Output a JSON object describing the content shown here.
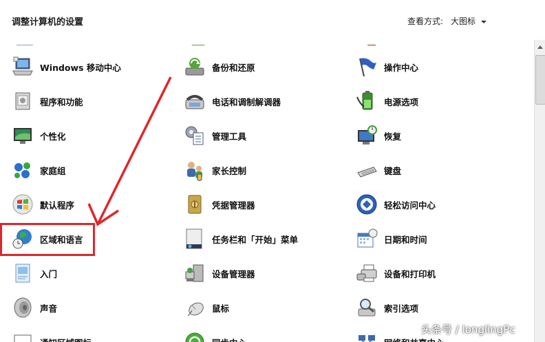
{
  "header": {
    "title": "调整计算机的设置",
    "view_by_label": "查看方式:",
    "view_by_value": "大图标"
  },
  "items": [
    {
      "id": "windows-mobility",
      "label": "Windows 移动中心",
      "icon": "laptop-icon"
    },
    {
      "id": "backup-restore",
      "label": "备份和还原",
      "icon": "backup-icon"
    },
    {
      "id": "action-center",
      "label": "操作中心",
      "icon": "flag-icon"
    },
    {
      "id": "programs-features",
      "label": "程序和功能",
      "icon": "programs-icon"
    },
    {
      "id": "phone-modem",
      "label": "电话和调制解调器",
      "icon": "phone-icon"
    },
    {
      "id": "power-options",
      "label": "电源选项",
      "icon": "battery-icon"
    },
    {
      "id": "personalization",
      "label": "个性化",
      "icon": "monitor-icon"
    },
    {
      "id": "admin-tools",
      "label": "管理工具",
      "icon": "gear-checklist-icon"
    },
    {
      "id": "recovery",
      "label": "恢复",
      "icon": "recovery-icon"
    },
    {
      "id": "homegroup",
      "label": "家庭组",
      "icon": "homegroup-icon"
    },
    {
      "id": "parental-controls",
      "label": "家长控制",
      "icon": "parental-icon"
    },
    {
      "id": "keyboard",
      "label": "键盘",
      "icon": "keyboard-icon"
    },
    {
      "id": "default-programs",
      "label": "默认程序",
      "icon": "windows-logo-icon"
    },
    {
      "id": "credential-manager",
      "label": "凭据管理器",
      "icon": "vault-icon"
    },
    {
      "id": "ease-of-access",
      "label": "轻松访问中心",
      "icon": "accessibility-icon"
    },
    {
      "id": "region-language",
      "label": "区域和语言",
      "icon": "globe-clock-icon"
    },
    {
      "id": "taskbar-start",
      "label": "任务栏和「开始」菜单",
      "icon": "taskbar-icon"
    },
    {
      "id": "date-time",
      "label": "日期和时间",
      "icon": "calendar-icon"
    },
    {
      "id": "getting-started",
      "label": "入门",
      "icon": "getting-started-icon"
    },
    {
      "id": "device-manager",
      "label": "设备管理器",
      "icon": "device-manager-icon"
    },
    {
      "id": "devices-printers",
      "label": "设备和打印机",
      "icon": "printer-icon"
    },
    {
      "id": "sound",
      "label": "声音",
      "icon": "speaker-icon"
    },
    {
      "id": "mouse",
      "label": "鼠标",
      "icon": "mouse-icon"
    },
    {
      "id": "indexing-options",
      "label": "索引选项",
      "icon": "magnifier-icon"
    },
    {
      "id": "notification-area",
      "label": "通知区域图标",
      "icon": "notification-icon"
    },
    {
      "id": "sync-center",
      "label": "同步中心",
      "icon": "sync-icon"
    },
    {
      "id": "network-sharing",
      "label": "网络和共享中心",
      "icon": "network-icon"
    }
  ],
  "watermark": "头条号 / longlingPc",
  "colors": {
    "highlight": "#e0262b",
    "background": "#ffffff"
  }
}
